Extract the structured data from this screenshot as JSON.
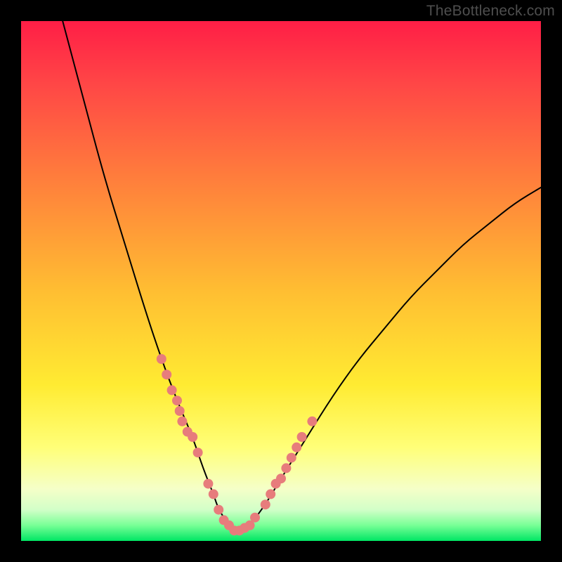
{
  "watermark": "TheBottleneck.com",
  "chart_data": {
    "type": "line",
    "title": "",
    "xlabel": "",
    "ylabel": "",
    "xlim": [
      0,
      100
    ],
    "ylim": [
      0,
      100
    ],
    "grid": false,
    "legend": false,
    "series": [
      {
        "name": "bottleneck-curve",
        "x": [
          8,
          12,
          16,
          20,
          24,
          27,
          30,
          33,
          35,
          37,
          38,
          40,
          42,
          44,
          47,
          50,
          55,
          60,
          65,
          70,
          75,
          80,
          85,
          90,
          95,
          100
        ],
        "y": [
          100,
          85,
          70,
          57,
          44,
          35,
          27,
          20,
          14,
          9,
          6,
          3,
          2,
          3,
          7,
          12,
          20,
          28,
          35,
          41,
          47,
          52,
          57,
          61,
          65,
          68
        ]
      }
    ],
    "dots": {
      "name": "highlighted-points",
      "color": "#e77c7c",
      "x": [
        27,
        28,
        29,
        30,
        30.5,
        31,
        32,
        33,
        34,
        36,
        37,
        38,
        39,
        40,
        41,
        42,
        43,
        44,
        45,
        47,
        48,
        49,
        50,
        51,
        52,
        53,
        54,
        56
      ],
      "y": [
        35,
        32,
        29,
        27,
        25,
        23,
        21,
        20,
        17,
        11,
        9,
        6,
        4,
        3,
        2,
        2,
        2.5,
        3,
        4.5,
        7,
        9,
        11,
        12,
        14,
        16,
        18,
        20,
        23
      ]
    },
    "background_gradient": {
      "top": "#ff1e46",
      "upper_mid": "#ff7d3c",
      "mid": "#ffeb32",
      "lower_mid": "#f5ffc8",
      "bottom": "#00e664"
    }
  }
}
